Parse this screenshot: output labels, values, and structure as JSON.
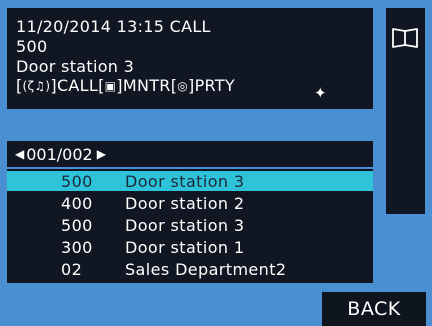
{
  "call_info": {
    "datetime_status": "11/20/2014 13:15 CALL",
    "number": "500",
    "station": "Door station 3",
    "actions": [
      {
        "icon": "speaker-call-icon",
        "glyph": "(ζ♫)",
        "label": "CALL"
      },
      {
        "icon": "monitor-icon",
        "glyph": "▣",
        "label": "MNTR"
      },
      {
        "icon": "party-icon",
        "glyph": "◎",
        "label": "PRTY"
      }
    ],
    "move_glyph": "✦"
  },
  "page": {
    "left_arrow": "◀",
    "current": "001/002",
    "right_arrow": "▶"
  },
  "list": {
    "items": [
      {
        "number": "500",
        "name": "Door station 3"
      },
      {
        "number": "400",
        "name": "Door station 2"
      },
      {
        "number": "500",
        "name": "Door station 3"
      },
      {
        "number": "300",
        "name": "Door station 1"
      },
      {
        "number": "02",
        "name": "Sales Department2"
      }
    ],
    "selected_index": 0
  },
  "back_label": "BACK",
  "colors": {
    "background": "#4a8fd2",
    "panel": "#111722",
    "selected": "#2fc3d9"
  }
}
